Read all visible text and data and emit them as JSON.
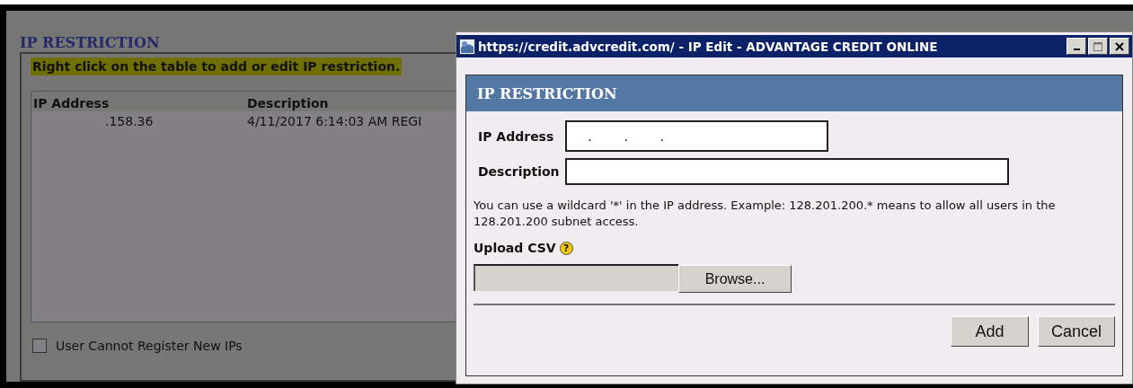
{
  "page": {
    "title": "IP RESTRICTION",
    "hint": "Right click on the table to add or edit IP restriction.",
    "table": {
      "columns": [
        "IP Address",
        "Description"
      ],
      "rows": [
        {
          "cells": [
            ".158.36",
            "4/11/2017 6:14:03 AM REGI"
          ]
        }
      ]
    },
    "checkbox": {
      "label": "User Cannot Register New IPs",
      "checked": false
    }
  },
  "dialog": {
    "window": {
      "title": "https://credit.advcredit.com/ - IP Edit - ADVANTAGE CREDIT ONLINE",
      "controls": [
        {
          "kind": "minimize"
        },
        {
          "kind": "maximize"
        },
        {
          "kind": "close"
        }
      ]
    },
    "header": "IP RESTRICTION",
    "fields": [
      {
        "label": "IP Address",
        "value": "    .        .        .",
        "kind": "ip"
      },
      {
        "label": "Description",
        "kind": "text"
      }
    ],
    "note": "You can use a wildcard '*' in the IP address. Example: 128.201.200.* means to allow all users in the 128.201.200 subnet access.",
    "upload": {
      "label": "Upload CSV",
      "help": "?",
      "button": "Browse..."
    },
    "buttons": [
      "Add",
      "Cancel"
    ]
  }
}
